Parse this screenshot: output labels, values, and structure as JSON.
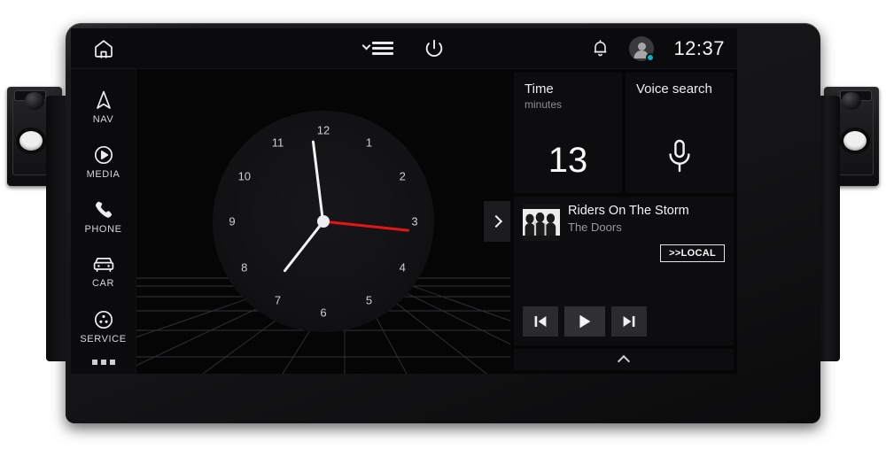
{
  "device": {
    "name": "car-head-unit"
  },
  "topbar": {
    "home_icon": "home-icon",
    "menu_icon": "hamburger-menu-icon",
    "power_icon": "power-icon",
    "notifications_icon": "bell-icon",
    "avatar_icon": "user-avatar-icon",
    "status_dot_color": "#00b5cc",
    "time": "12:37"
  },
  "sidebar": {
    "items": [
      {
        "label": "NAV",
        "icon": "navigation-arrow-icon"
      },
      {
        "label": "MEDIA",
        "icon": "play-circle-icon"
      },
      {
        "label": "PHONE",
        "icon": "phone-handset-icon"
      },
      {
        "label": "CAR",
        "icon": "car-icon"
      },
      {
        "label": "SERVICE",
        "icon": "service-wheel-icon"
      }
    ],
    "more_label": "more-apps-dots"
  },
  "clock": {
    "numbers": [
      "12",
      "1",
      "2",
      "3",
      "4",
      "5",
      "6",
      "7",
      "8",
      "9",
      "10",
      "11"
    ],
    "hour_angle": 218,
    "minute_angle": 353,
    "second_angle": 96,
    "second_hand_color": "#e51515",
    "hand_color": "#f2f2f2",
    "expand_icon": "chevron-right-icon"
  },
  "widgets": {
    "time_widget": {
      "title": "Time",
      "subtitle": "minutes",
      "value": "13"
    },
    "voice_widget": {
      "title": "Voice search",
      "icon": "microphone-icon"
    }
  },
  "media": {
    "track_title": "Riders On The Storm",
    "artist": "The Doors",
    "source_badge": ">>LOCAL",
    "album_art_alt": "album-artwork",
    "controls": [
      {
        "name": "previous-track-button",
        "icon": "skip-previous-icon"
      },
      {
        "name": "play-button",
        "icon": "play-icon"
      },
      {
        "name": "next-track-button",
        "icon": "skip-next-icon"
      }
    ]
  },
  "drawer": {
    "handle_icon": "chevron-up-icon"
  }
}
